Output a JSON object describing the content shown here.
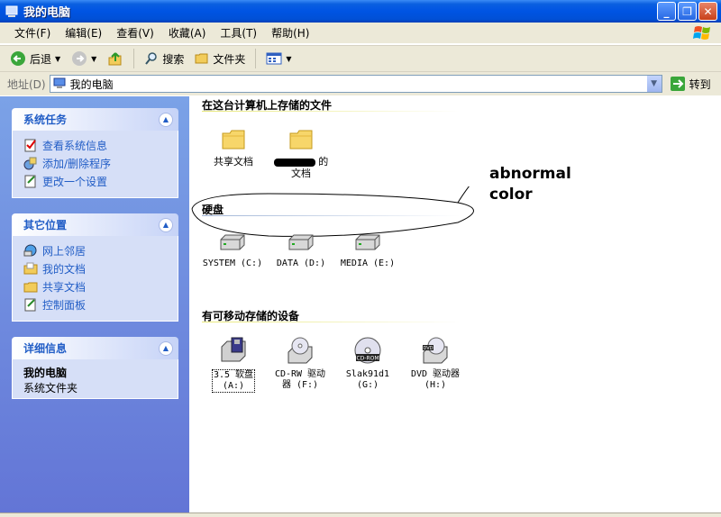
{
  "window": {
    "title": "我的电脑",
    "buttons": {
      "minimize": "_",
      "maximize": "❐",
      "close": "✕"
    }
  },
  "menubar": {
    "items": [
      "文件(F)",
      "编辑(E)",
      "查看(V)",
      "收藏(A)",
      "工具(T)",
      "帮助(H)"
    ]
  },
  "toolbar": {
    "back_label": "后退",
    "search_label": "搜索",
    "folders_label": "文件夹"
  },
  "address": {
    "label": "地址(D)",
    "value": "我的电脑",
    "go_label": "转到"
  },
  "sidebar": {
    "system_tasks": {
      "title": "系统任务",
      "items": [
        "查看系统信息",
        "添加/删除程序",
        "更改一个设置"
      ]
    },
    "other_places": {
      "title": "其它位置",
      "items": [
        "网上邻居",
        "我的文档",
        "共享文档",
        "控制面板"
      ]
    },
    "details": {
      "title": "详细信息",
      "name": "我的电脑",
      "desc": "系统文件夹"
    }
  },
  "content": {
    "files_section": {
      "title": "在这台计算机上存储的文件",
      "items": [
        {
          "label": "共享文档"
        },
        {
          "label_line1": "的",
          "label_line2": "文档"
        }
      ]
    },
    "hdd_section": {
      "title": "硬盘",
      "items": [
        {
          "label": "SYSTEM (C:)"
        },
        {
          "label": "DATA (D:)"
        },
        {
          "label": "MEDIA (E:)"
        }
      ]
    },
    "removable_section": {
      "title": "有可移动存储的设备",
      "items": [
        {
          "line1": "3.5 软盘",
          "line2": "(A:)"
        },
        {
          "line1": "CD-RW 驱动",
          "line2": "器 (F:)"
        },
        {
          "line1": "Slak91d1",
          "line2": "(G:)"
        },
        {
          "line1": "DVD 驱动器",
          "line2": "(H:)"
        }
      ]
    }
  },
  "annotation": {
    "line1": "abnormal",
    "line2": "color"
  },
  "icons": [
    "computer-icon",
    "back-icon",
    "forward-icon",
    "up-folder-icon",
    "search-icon",
    "folders-icon",
    "views-icon",
    "go-icon",
    "folder-icon",
    "hard-disk-icon",
    "floppy-icon",
    "cd-drive-icon",
    "cd-rom-icon",
    "dvd-icon",
    "collapse-icon"
  ],
  "colors": {
    "titlebar": "#0054e3",
    "sidebar": "#7ba2e7",
    "link": "#215dc6"
  }
}
